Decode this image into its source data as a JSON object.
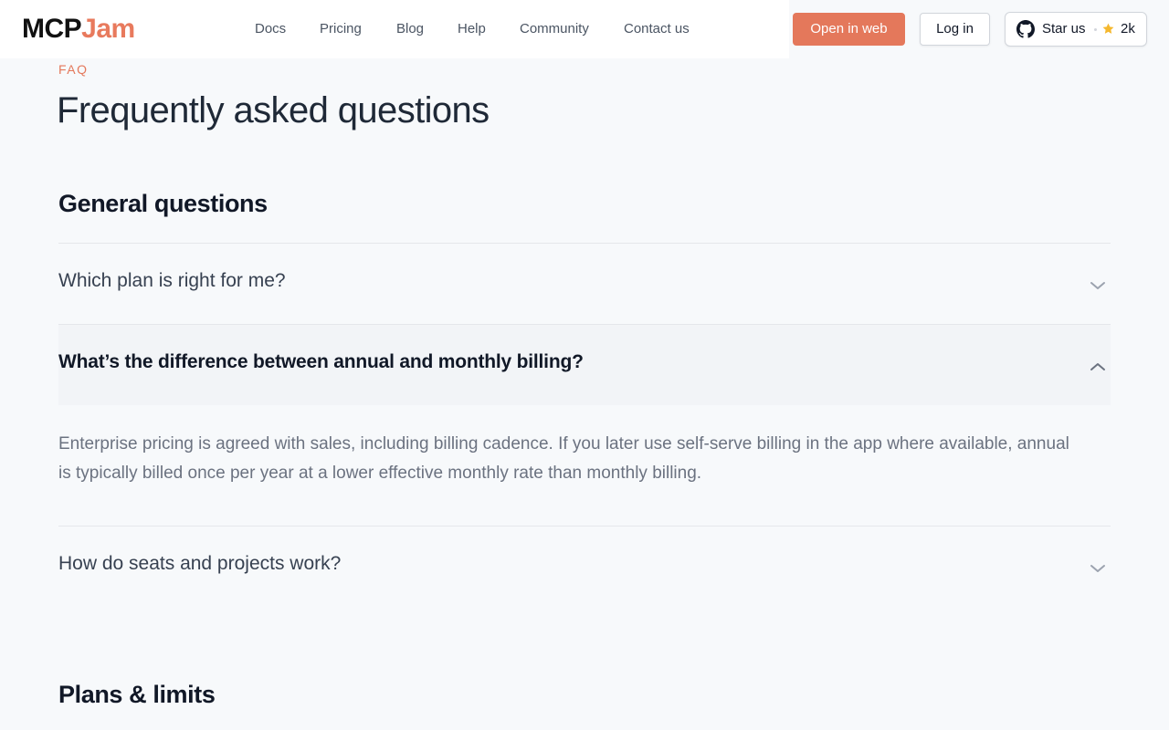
{
  "brand": {
    "logo_part1": "MCP",
    "logo_part2": "Jam",
    "accent": "#e4785b"
  },
  "nav": {
    "items": [
      "Docs",
      "Pricing",
      "Blog",
      "Help",
      "Community",
      "Contact us"
    ]
  },
  "actions": {
    "open_web": "Open in web",
    "login": "Log in",
    "star_label": "Star us",
    "star_count": "2k"
  },
  "faq": {
    "eyebrow": "FAQ",
    "title": "Frequently asked questions",
    "sections": [
      {
        "title": "General questions",
        "items": [
          {
            "question": "Which plan is right for me?",
            "expanded": false
          },
          {
            "question": "What’s the difference between annual and monthly billing?",
            "expanded": true,
            "answer": "Enterprise pricing is agreed with sales, including billing cadence. If you later use self-serve billing in the app where available, annual is typically billed once per year at a lower effective monthly rate than monthly billing."
          },
          {
            "question": "How do seats and projects work?",
            "expanded": false
          }
        ]
      },
      {
        "title": "Plans & limits"
      }
    ]
  }
}
